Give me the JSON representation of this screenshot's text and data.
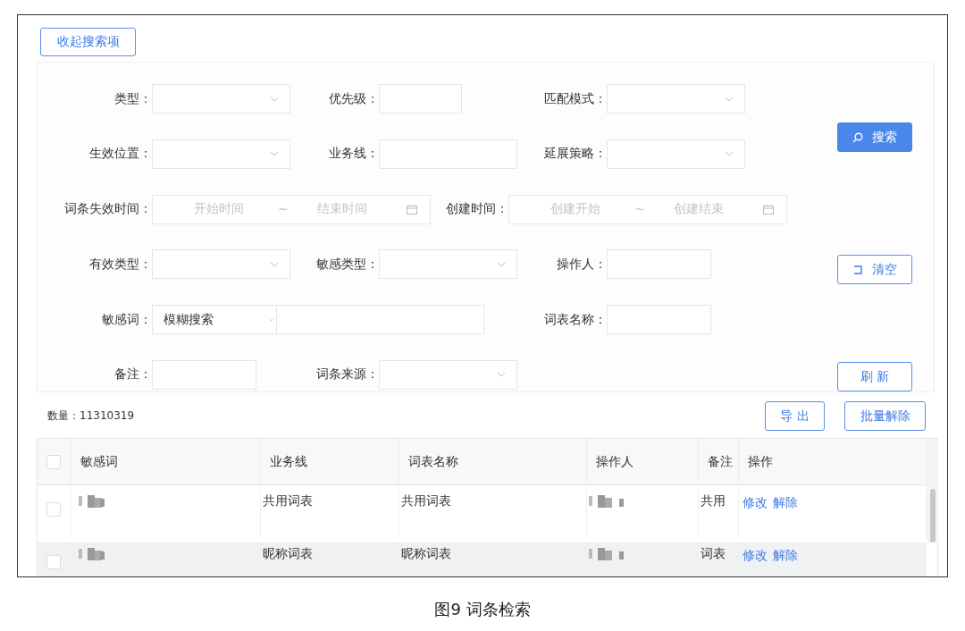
{
  "collapse_button": "收起搜索项",
  "filters": [
    [
      {
        "label": "类型：",
        "kind": "select"
      },
      {
        "label": "优先级：",
        "kind": "small-input"
      },
      {
        "label": "匹配模式：",
        "kind": "select"
      }
    ],
    [
      {
        "label": "生效位置：",
        "kind": "select"
      },
      {
        "label": "业务线：",
        "kind": "wide-input"
      },
      {
        "label": "延展策略：",
        "kind": "select"
      }
    ],
    [
      {
        "label": "词条失效时间：",
        "kind": "daterange",
        "start_placeholder": "开始时间",
        "separator": "~",
        "end_placeholder": "结束时间"
      },
      {
        "label": "创建时间：",
        "kind": "daterange",
        "start_placeholder": "创建开始",
        "separator": "~",
        "end_placeholder": "创建结束"
      }
    ],
    [
      {
        "label": "有效类型：",
        "kind": "select"
      },
      {
        "label": "敏感类型：",
        "kind": "select"
      },
      {
        "label": "操作人：",
        "kind": "input"
      }
    ],
    [
      {
        "label": "敏感词：",
        "kind": "combo",
        "mode": "模糊搜索"
      },
      {
        "label": "词表名称：",
        "kind": "input"
      }
    ],
    [
      {
        "label": "备注：",
        "kind": "input"
      },
      {
        "label": "词条来源：",
        "kind": "select"
      }
    ]
  ],
  "actions": [
    {
      "label": "搜索",
      "kind": "primary"
    },
    {
      "label": "清空",
      "kind": "clear"
    },
    {
      "label": "刷 新",
      "kind": "plain"
    }
  ],
  "count": "数量：11310319",
  "toolbar_buttons": [
    "导 出",
    "批量解除"
  ],
  "table": {
    "select_all_checked": false,
    "columns": [
      "敏感词",
      "业务线",
      "词表名称",
      "操作人",
      "备注",
      "操作"
    ],
    "rows": [
      {
        "checked": false,
        "highlighted": false,
        "business_line": "共用词表",
        "wordlist": "共用词表",
        "note": "共用",
        "actions": [
          "修改",
          "解除"
        ]
      },
      {
        "checked": false,
        "highlighted": true,
        "business_line": "昵称词表",
        "wordlist": "昵称词表",
        "note": "词表",
        "actions": [
          "修改",
          "解除"
        ]
      }
    ]
  },
  "caption": "图9 词条检索"
}
